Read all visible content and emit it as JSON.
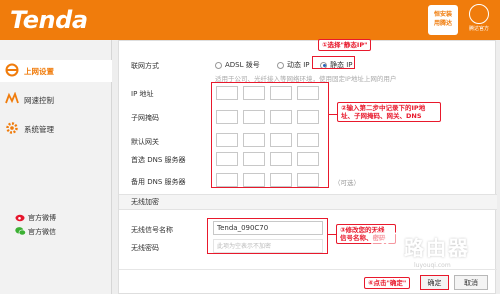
{
  "header": {
    "logo": "Tenda",
    "promo_line1": "恒安装",
    "promo_line2": "用腾达",
    "brand_line": "腾达官方"
  },
  "sidebar": {
    "items": [
      {
        "label": "上网设置",
        "icon": "ie-icon",
        "active": true
      },
      {
        "label": "网速控制",
        "icon": "speed-icon",
        "active": false
      },
      {
        "label": "系统管理",
        "icon": "gear-icon",
        "active": false
      }
    ],
    "social": [
      {
        "label": "官方微博",
        "icon": "weibo-icon"
      },
      {
        "label": "官方微信",
        "icon": "wechat-icon"
      }
    ]
  },
  "wan": {
    "mode_label": "联网方式",
    "options": [
      {
        "label": "ADSL 拨号",
        "selected": false
      },
      {
        "label": "动态 IP",
        "selected": false
      },
      {
        "label": "静态 IP",
        "selected": true
      }
    ],
    "hint": "适用于公司、光纤接入等网络环境，使用固定IP地址上网的用户",
    "fields": [
      {
        "label": "IP 地址"
      },
      {
        "label": "子网掩码"
      },
      {
        "label": "默认网关"
      },
      {
        "label": "首选 DNS 服务器"
      },
      {
        "label": "备用 DNS 服务器",
        "suffix": "（可选）"
      }
    ]
  },
  "wireless": {
    "section_title": "无线加密",
    "ssid_label": "无线信号名称",
    "ssid_value": "Tenda_090C70",
    "password_label": "无线密码",
    "password_placeholder": "此项为空表示不加密"
  },
  "annotations": {
    "a1": {
      "num": "①",
      "text": "选择\"静态IP\""
    },
    "a2": {
      "num": "②",
      "line1": "输入第二步中记录下的IP地",
      "line2": "址、子网掩码、网关、DNS"
    },
    "a3": {
      "num": "③",
      "line1": "修改您的无线",
      "line2": "信号名称、密码"
    },
    "a4": {
      "num": "④",
      "text": "点击\"确定\""
    }
  },
  "buttons": {
    "ok": "确定",
    "cancel": "取消"
  },
  "watermark": {
    "text": "路由器",
    "sub": "luyouqi.com"
  },
  "colors": {
    "brand": "#f07c0c",
    "annotation": "#e8192c"
  }
}
